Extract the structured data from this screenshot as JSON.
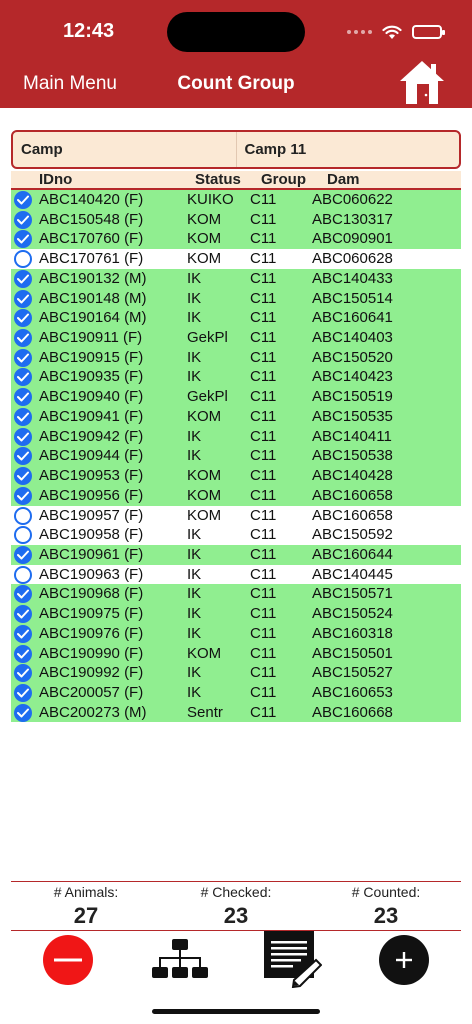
{
  "status_bar": {
    "time": "12:43"
  },
  "nav": {
    "back_label": "Main Menu",
    "title": "Count Group",
    "home_icon": "house-icon"
  },
  "camp": {
    "label": "Camp",
    "value": "Camp 11"
  },
  "columns": {
    "id": "IDno",
    "status": "Status",
    "group": "Group",
    "dam": "Dam"
  },
  "rows": [
    {
      "id": "ABC140420 (F)",
      "status": "KUIKO",
      "group": "C11",
      "dam": "ABC060622",
      "checked": true
    },
    {
      "id": "ABC150548 (F)",
      "status": "KOM",
      "group": "C11",
      "dam": "ABC130317",
      "checked": true
    },
    {
      "id": "ABC170760 (F)",
      "status": "KOM",
      "group": "C11",
      "dam": "ABC090901",
      "checked": true
    },
    {
      "id": "ABC170761 (F)",
      "status": "KOM",
      "group": "C11",
      "dam": "ABC060628",
      "checked": false
    },
    {
      "id": "ABC190132 (M)",
      "status": "IK",
      "group": "C11",
      "dam": "ABC140433",
      "checked": true
    },
    {
      "id": "ABC190148 (M)",
      "status": "IK",
      "group": "C11",
      "dam": "ABC150514",
      "checked": true
    },
    {
      "id": "ABC190164 (M)",
      "status": "IK",
      "group": "C11",
      "dam": "ABC160641",
      "checked": true
    },
    {
      "id": "ABC190911 (F)",
      "status": "GekPl",
      "group": "C11",
      "dam": "ABC140403",
      "checked": true
    },
    {
      "id": "ABC190915 (F)",
      "status": "IK",
      "group": "C11",
      "dam": "ABC150520",
      "checked": true
    },
    {
      "id": "ABC190935 (F)",
      "status": "IK",
      "group": "C11",
      "dam": "ABC140423",
      "checked": true
    },
    {
      "id": "ABC190940 (F)",
      "status": "GekPl",
      "group": "C11",
      "dam": "ABC150519",
      "checked": true
    },
    {
      "id": "ABC190941 (F)",
      "status": "KOM",
      "group": "C11",
      "dam": "ABC150535",
      "checked": true
    },
    {
      "id": "ABC190942 (F)",
      "status": "IK",
      "group": "C11",
      "dam": "ABC140411",
      "checked": true
    },
    {
      "id": "ABC190944 (F)",
      "status": "IK",
      "group": "C11",
      "dam": "ABC150538",
      "checked": true
    },
    {
      "id": "ABC190953 (F)",
      "status": "KOM",
      "group": "C11",
      "dam": "ABC140428",
      "checked": true
    },
    {
      "id": "ABC190956 (F)",
      "status": "KOM",
      "group": "C11",
      "dam": "ABC160658",
      "checked": true
    },
    {
      "id": "ABC190957 (F)",
      "status": "KOM",
      "group": "C11",
      "dam": "ABC160658",
      "checked": false
    },
    {
      "id": "ABC190958 (F)",
      "status": "IK",
      "group": "C11",
      "dam": "ABC150592",
      "checked": false
    },
    {
      "id": "ABC190961 (F)",
      "status": "IK",
      "group": "C11",
      "dam": "ABC160644",
      "checked": true
    },
    {
      "id": "ABC190963 (F)",
      "status": "IK",
      "group": "C11",
      "dam": "ABC140445",
      "checked": false
    },
    {
      "id": "ABC190968 (F)",
      "status": "IK",
      "group": "C11",
      "dam": "ABC150571",
      "checked": true
    },
    {
      "id": "ABC190975 (F)",
      "status": "IK",
      "group": "C11",
      "dam": "ABC150524",
      "checked": true
    },
    {
      "id": "ABC190976 (F)",
      "status": "IK",
      "group": "C11",
      "dam": "ABC160318",
      "checked": true
    },
    {
      "id": "ABC190990 (F)",
      "status": "KOM",
      "group": "C11",
      "dam": "ABC150501",
      "checked": true
    },
    {
      "id": "ABC190992 (F)",
      "status": "IK",
      "group": "C11",
      "dam": "ABC150527",
      "checked": true
    },
    {
      "id": "ABC200057 (F)",
      "status": "IK",
      "group": "C11",
      "dam": "ABC160653",
      "checked": true
    },
    {
      "id": "ABC200273 (M)",
      "status": "Sentr",
      "group": "C11",
      "dam": "ABC160668",
      "checked": true
    }
  ],
  "stats": {
    "animals_label": "# Animals:",
    "animals_value": "27",
    "checked_label": "# Checked:",
    "checked_value": "23",
    "counted_label": "# Counted:",
    "counted_value": "23"
  },
  "toolbar": {
    "remove_icon": "minus-circle-icon",
    "group_icon": "hierarchy-icon",
    "notes_icon": "document-edit-icon",
    "add_icon": "plus-circle-icon"
  },
  "colors": {
    "brand_red": "#b5282a",
    "checked_row": "#90ee90",
    "check_blue": "#1e6cf0",
    "camp_bg": "#fbe9d5"
  }
}
